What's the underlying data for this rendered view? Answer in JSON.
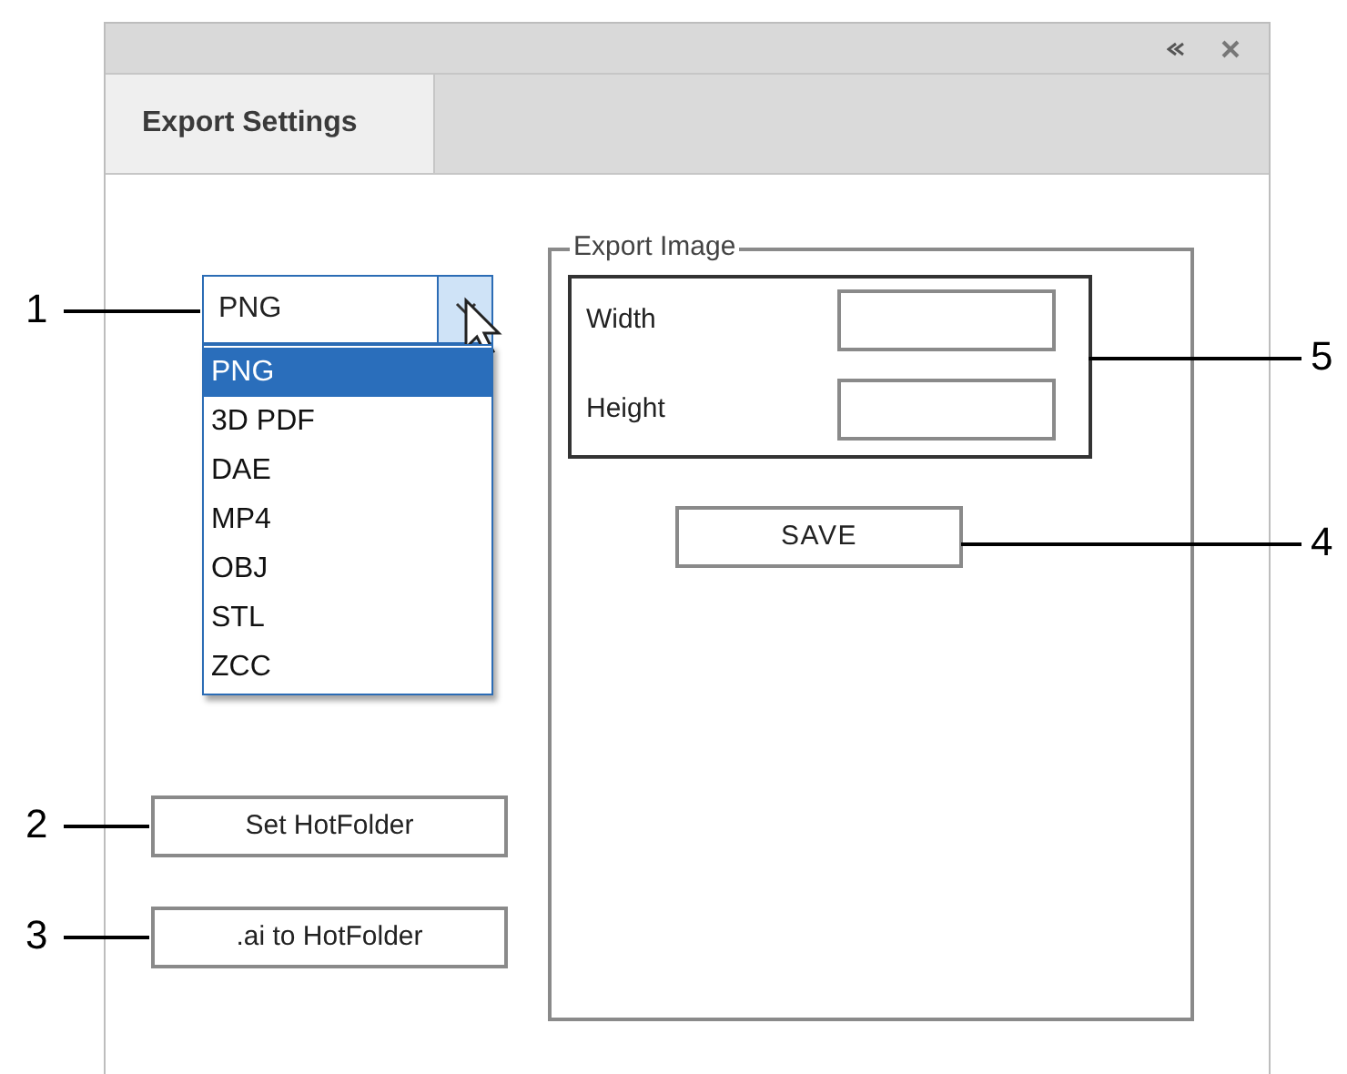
{
  "panel": {
    "tabs": [
      {
        "label": "Export Settings",
        "selected": true
      }
    ]
  },
  "format_dropdown": {
    "value": "PNG",
    "expanded": true,
    "options": [
      {
        "label": "PNG",
        "selected": true
      },
      {
        "label": "3D PDF",
        "selected": false
      },
      {
        "label": "DAE",
        "selected": false
      },
      {
        "label": "MP4",
        "selected": false
      },
      {
        "label": "OBJ",
        "selected": false
      },
      {
        "label": "STL",
        "selected": false
      },
      {
        "label": "ZCC",
        "selected": false
      }
    ]
  },
  "buttons": [
    "Set HotFolder",
    ".ai to HotFolder"
  ],
  "export_image": {
    "title": "Export Image",
    "fields": [
      {
        "label": "Width"
      },
      {
        "label": "Height"
      }
    ],
    "save_button": "SAVE"
  },
  "callouts": [
    "1",
    "2",
    "3",
    "4",
    "5"
  ]
}
